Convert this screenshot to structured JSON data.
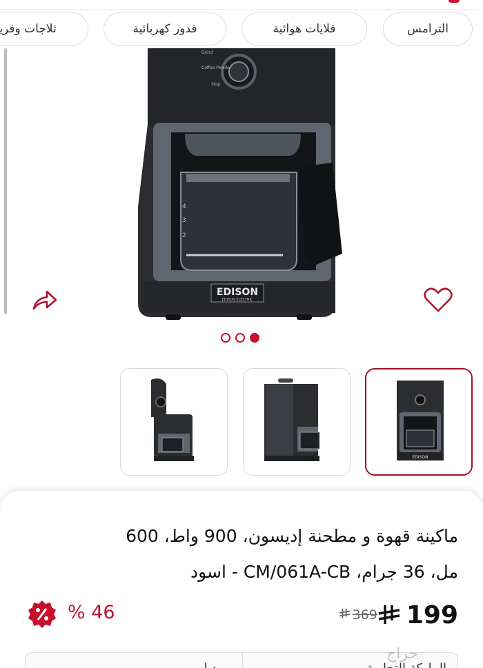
{
  "categories": [
    "الترامس",
    "قلايات هوائية",
    "قدور كهربائية",
    "ثلاجات وفريزرات"
  ],
  "product": {
    "brand_text": "EDISON",
    "brand_sub": "EDISON ELECTRIC",
    "knob_labels": [
      "Grind",
      "Coffee Powder",
      "Stop"
    ],
    "title_line1": "ماكينة قهوة و مطحنة إديسون، 900 واط، 600",
    "title_line2": "مل، 36 جرام، CM/061A-CB - اسود",
    "price": "199",
    "old_price": "369",
    "discount": "% 46",
    "discount_icon": "percent-badge-icon"
  },
  "gallery": {
    "dots": 3,
    "active_dot": 3,
    "thumbnails": [
      "coffee-maker-lid-open",
      "coffee-maker-side",
      "coffee-maker-front"
    ],
    "selected_thumbnail": 3
  },
  "bottom_box": {
    "right_label": "الماركة التجارية",
    "left_label": "موديل"
  },
  "watermark": "حراج",
  "colors": {
    "accent": "#c8102e",
    "machine_body": "#2b2d31",
    "machine_trim": "#5f6670"
  }
}
